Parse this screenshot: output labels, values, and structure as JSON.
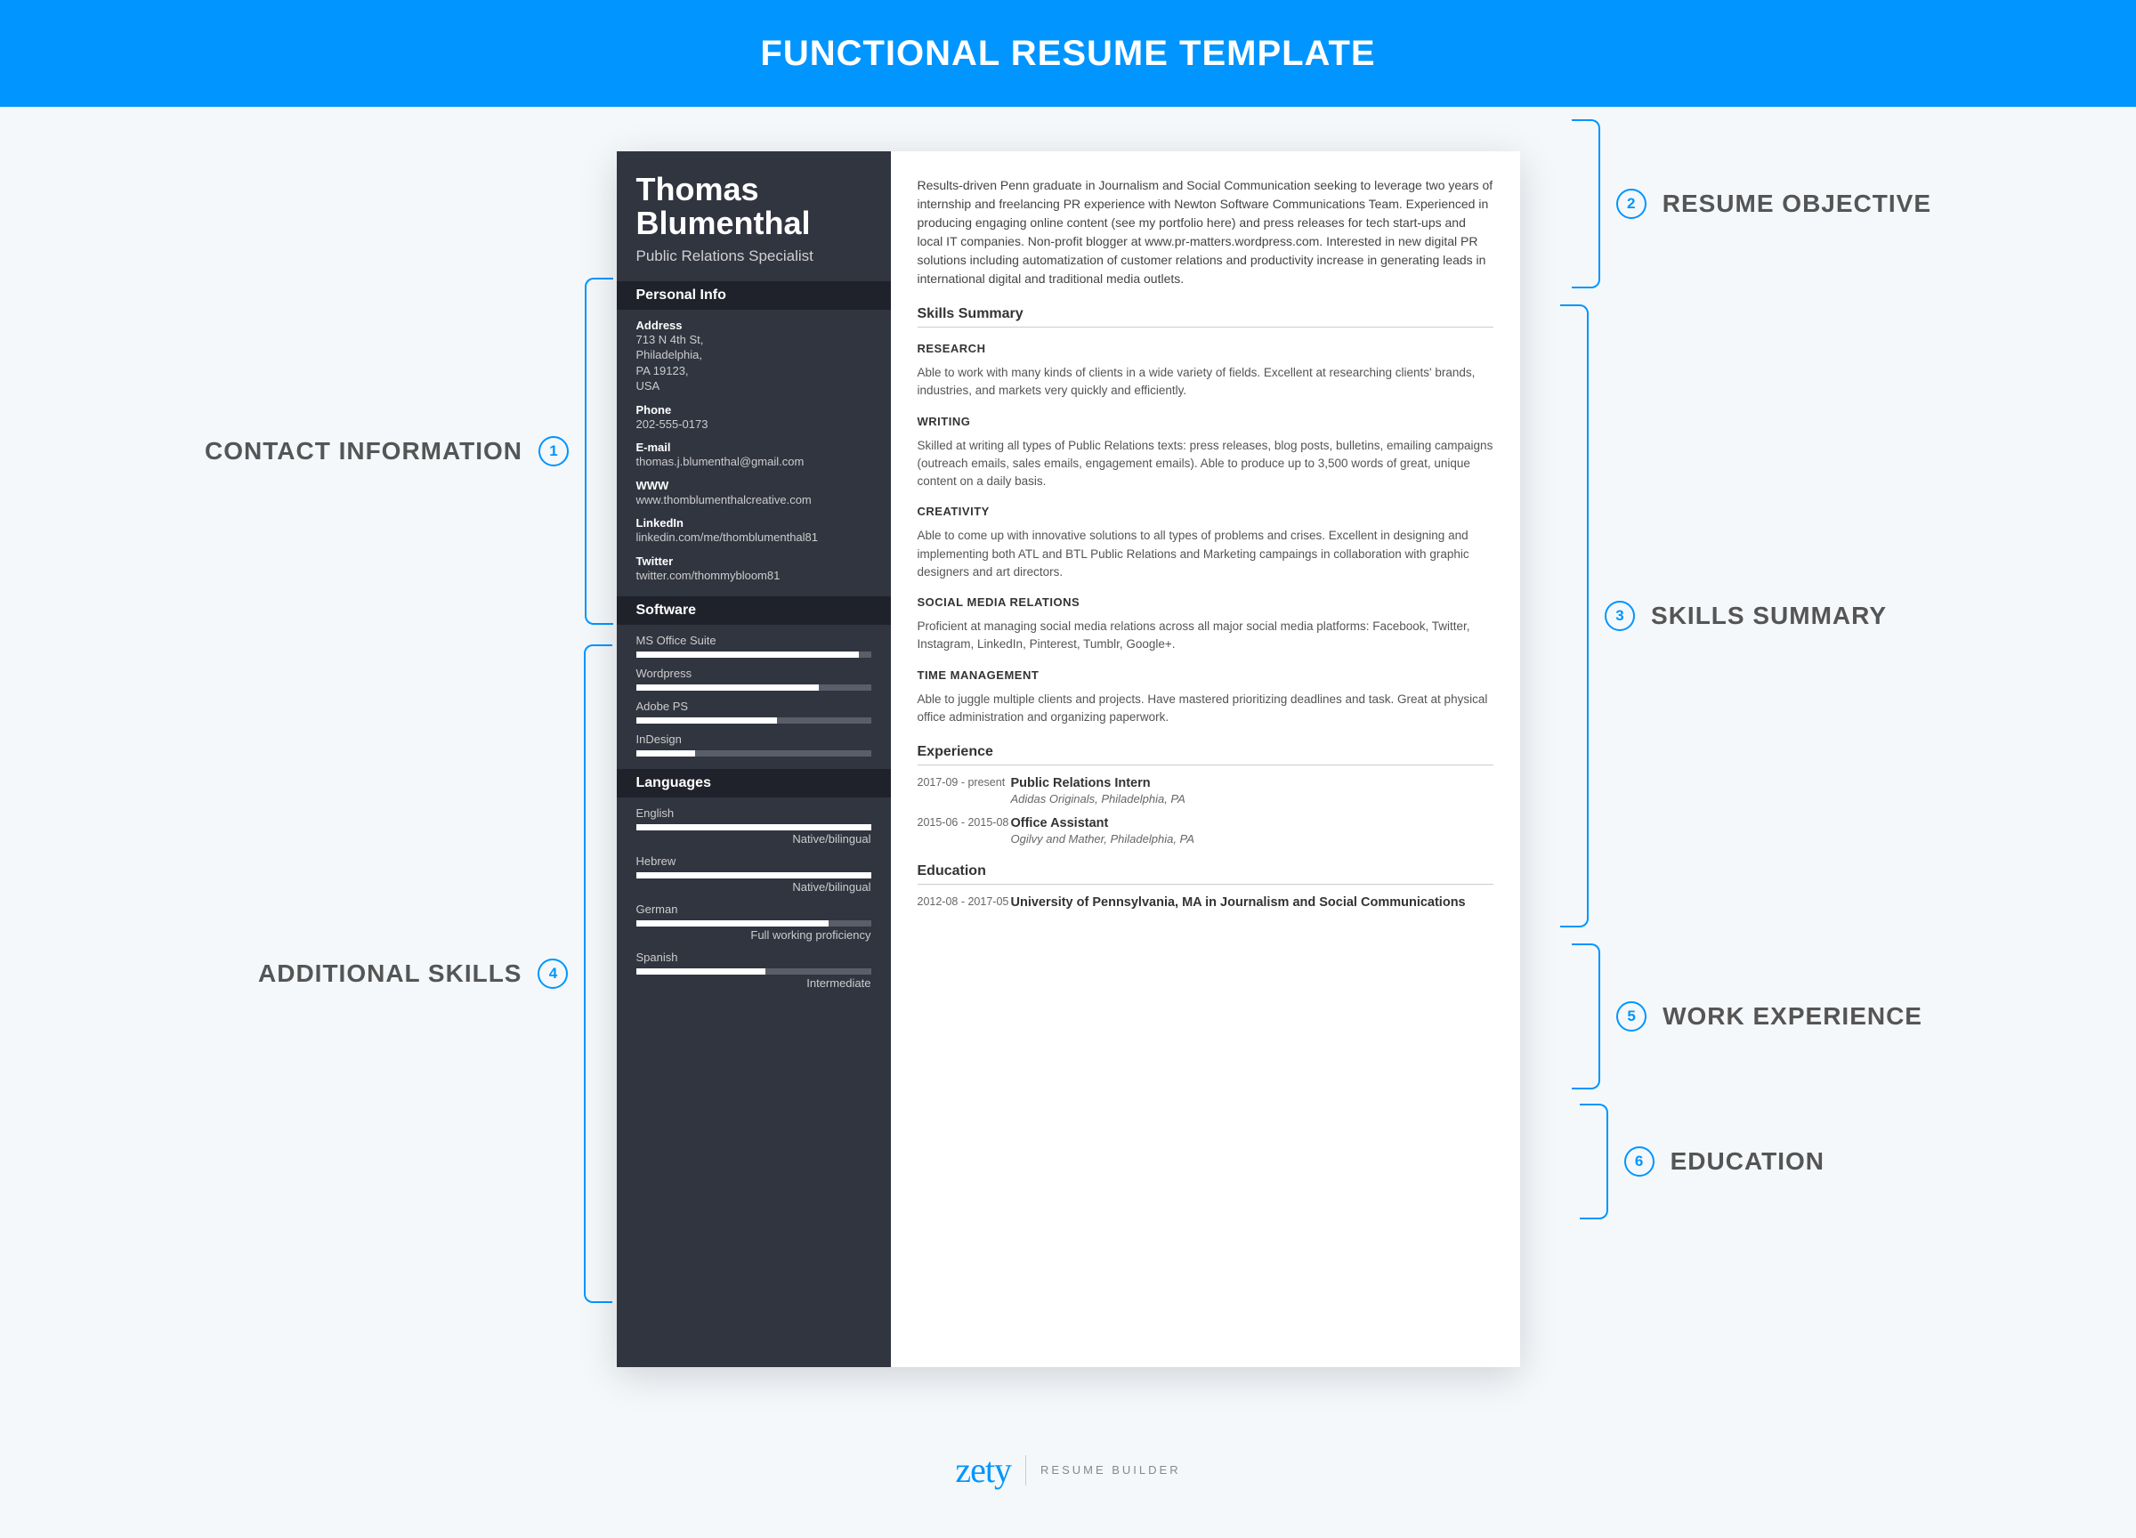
{
  "header": {
    "title": "FUNCTIONAL RESUME TEMPLATE"
  },
  "annotations": {
    "contact": {
      "num": "1",
      "label": "CONTACT INFORMATION"
    },
    "additional": {
      "num": "4",
      "label": "ADDITIONAL SKILLS"
    },
    "objective": {
      "num": "2",
      "label": "RESUME OBJECTIVE"
    },
    "skills_summary": {
      "num": "3",
      "label": "SKILLS SUMMARY"
    },
    "work": {
      "num": "5",
      "label": "WORK EXPERIENCE"
    },
    "education": {
      "num": "6",
      "label": "EDUCATION"
    }
  },
  "resume": {
    "name_first": "Thomas",
    "name_last": "Blumenthal",
    "title": "Public Relations Specialist",
    "personal_info_hdr": "Personal Info",
    "info": {
      "address_label": "Address",
      "address_line1": "713 N 4th St,",
      "address_line2": "Philadelphia,",
      "address_line3": "PA 19123,",
      "address_line4": "USA",
      "phone_label": "Phone",
      "phone": "202-555-0173",
      "email_label": "E-mail",
      "email": "thomas.j.blumenthal@gmail.com",
      "www_label": "WWW",
      "www": "www.thomblumenthalcreative.com",
      "linkedin_label": "LinkedIn",
      "linkedin": "linkedin.com/me/thomblumenthal81",
      "twitter_label": "Twitter",
      "twitter": "twitter.com/thommybloom81"
    },
    "software_hdr": "Software",
    "software": [
      {
        "name": "MS Office Suite",
        "pct": 95
      },
      {
        "name": "Wordpress",
        "pct": 78
      },
      {
        "name": "Adobe PS",
        "pct": 60
      },
      {
        "name": "InDesign",
        "pct": 25
      }
    ],
    "languages_hdr": "Languages",
    "languages": [
      {
        "name": "English",
        "level": "Native/bilingual",
        "pct": 100
      },
      {
        "name": "Hebrew",
        "level": "Native/bilingual",
        "pct": 100
      },
      {
        "name": "German",
        "level": "Full working proficiency",
        "pct": 82
      },
      {
        "name": "Spanish",
        "level": "Intermediate",
        "pct": 55
      }
    ],
    "objective": "Results-driven Penn graduate in Journalism and Social Communication seeking to leverage two years of internship and freelancing PR experience with Newton Software Communications Team. Experienced in producing engaging online content (see my portfolio here) and press releases for tech start-ups and local IT companies. Non-profit blogger at www.pr-matters.wordpress.com. Interested in new digital PR solutions including automatization of customer relations and productivity increase in generating leads in international digital and traditional media outlets.",
    "skills_summary_hdr": "Skills Summary",
    "skills": {
      "research_h": "RESEARCH",
      "research_p": "Able to work with many kinds of clients in a wide variety of fields. Excellent at researching clients' brands, industries, and markets very quickly and efficiently.",
      "writing_h": "WRITING",
      "writing_p": "Skilled at writing all types of Public Relations texts: press releases, blog posts, bulletins, emailing campaigns (outreach emails, sales emails, engagement emails). Able to produce up to 3,500 words of great, unique content on a daily basis.",
      "creativity_h": "CREATIVITY",
      "creativity_p": "Able to come up with innovative solutions to all types of problems and crises. Excellent in designing and implementing both ATL and BTL Public Relations and Marketing campaings in collaboration with graphic designers and art directors.",
      "social_h": "SOCIAL MEDIA RELATIONS",
      "social_p": "Proficient at managing social media relations across all major social media platforms: Facebook, Twitter, Instagram, LinkedIn, Pinterest, Tumblr, Google+.",
      "time_h": "TIME MANAGEMENT",
      "time_p": "Able to juggle multiple clients and projects. Have mastered prioritizing deadlines and task. Great at physical office administration and organizing paperwork."
    },
    "experience_hdr": "Experience",
    "experience": [
      {
        "date": "2017-09 - present",
        "title": "Public Relations Intern",
        "sub": "Adidas Originals, Philadelphia, PA"
      },
      {
        "date": "2015-06 - 2015-08",
        "title": "Office Assistant",
        "sub": "Ogilvy and Mather, Philadelphia, PA"
      }
    ],
    "education_hdr": "Education",
    "education": [
      {
        "date": "2012-08 - 2017-05",
        "title": "University of Pennsylvania, MA in Journalism and Social Communications"
      }
    ]
  },
  "footer": {
    "logo": "zety",
    "sub": "RESUME BUILDER"
  }
}
